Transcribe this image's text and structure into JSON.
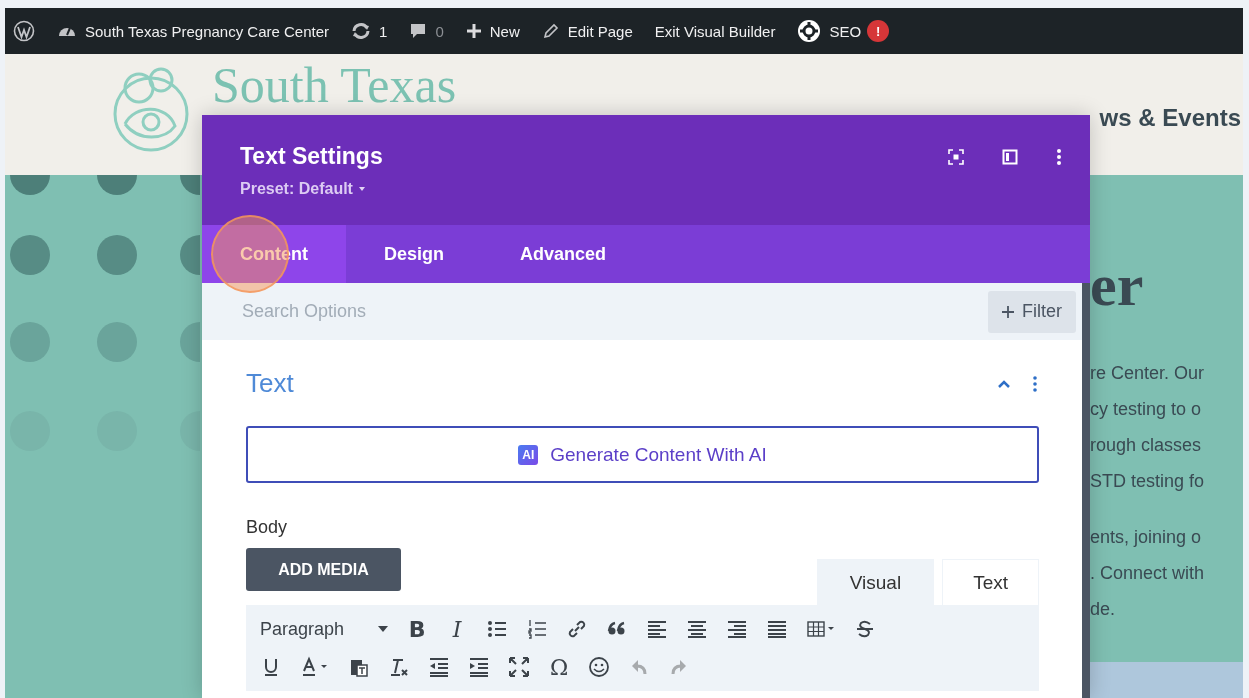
{
  "admin_bar": {
    "site": "South Texas Pregnancy Care Center",
    "updates": "1",
    "comments": "0",
    "new": "New",
    "edit": "Edit Page",
    "exit": "Exit Visual Builder",
    "seo": "SEO",
    "seo_badge": "!"
  },
  "site_header": {
    "logo_text": "South Texas",
    "nav": [
      "ws & Events"
    ]
  },
  "background_content": {
    "heading": "er",
    "paragraphs": [
      [
        "re Center. Our",
        "cy testing to o",
        "rough classes",
        "STD testing fo"
      ],
      [
        "ents, joining o",
        ". Connect with",
        "de."
      ]
    ]
  },
  "modal": {
    "title": "Text Settings",
    "preset": "Preset: Default",
    "tabs": [
      {
        "label": "Content",
        "selected": true
      },
      {
        "label": "Design",
        "selected": false
      },
      {
        "label": "Advanced",
        "selected": false
      }
    ],
    "search": {
      "placeholder": "Search Options"
    },
    "filter": "Filter",
    "section": {
      "title": "Text",
      "expanded": true
    },
    "ai_button": {
      "badge": "AI",
      "label": "Generate Content With AI"
    },
    "body_label": "Body",
    "add_media": "ADD MEDIA",
    "editor_tabs": [
      {
        "label": "Visual",
        "selected": true
      },
      {
        "label": "Text",
        "selected": false
      }
    ],
    "format": "Paragraph",
    "toolbar_rows": [
      [
        {
          "kind": "bold-glyph",
          "label": "B",
          "disabled": false
        },
        {
          "kind": "italic-glyph",
          "label": "I",
          "disabled": false
        },
        {
          "kind": "bullet-list",
          "disabled": false
        },
        {
          "kind": "numbered-list",
          "disabled": false
        },
        {
          "kind": "link",
          "disabled": false
        },
        {
          "kind": "quote",
          "disabled": false
        },
        {
          "kind": "align-left",
          "disabled": false
        },
        {
          "kind": "align-center",
          "disabled": false
        },
        {
          "kind": "align-right",
          "disabled": false
        },
        {
          "kind": "justify",
          "disabled": false
        },
        {
          "kind": "table",
          "disabled": false
        },
        {
          "kind": "strike",
          "disabled": false
        }
      ],
      [
        {
          "kind": "underline",
          "disabled": false
        },
        {
          "kind": "text-color",
          "disabled": false
        },
        {
          "kind": "paste",
          "disabled": false
        },
        {
          "kind": "clear-format",
          "disabled": false
        },
        {
          "kind": "outdent",
          "disabled": false
        },
        {
          "kind": "indent",
          "disabled": false
        },
        {
          "kind": "fullscreen",
          "disabled": false
        },
        {
          "kind": "glyph",
          "label": "Ω",
          "disabled": false
        },
        {
          "kind": "emoji",
          "disabled": false
        },
        {
          "kind": "undo",
          "disabled": true
        },
        {
          "kind": "redo",
          "disabled": true
        }
      ]
    ]
  }
}
